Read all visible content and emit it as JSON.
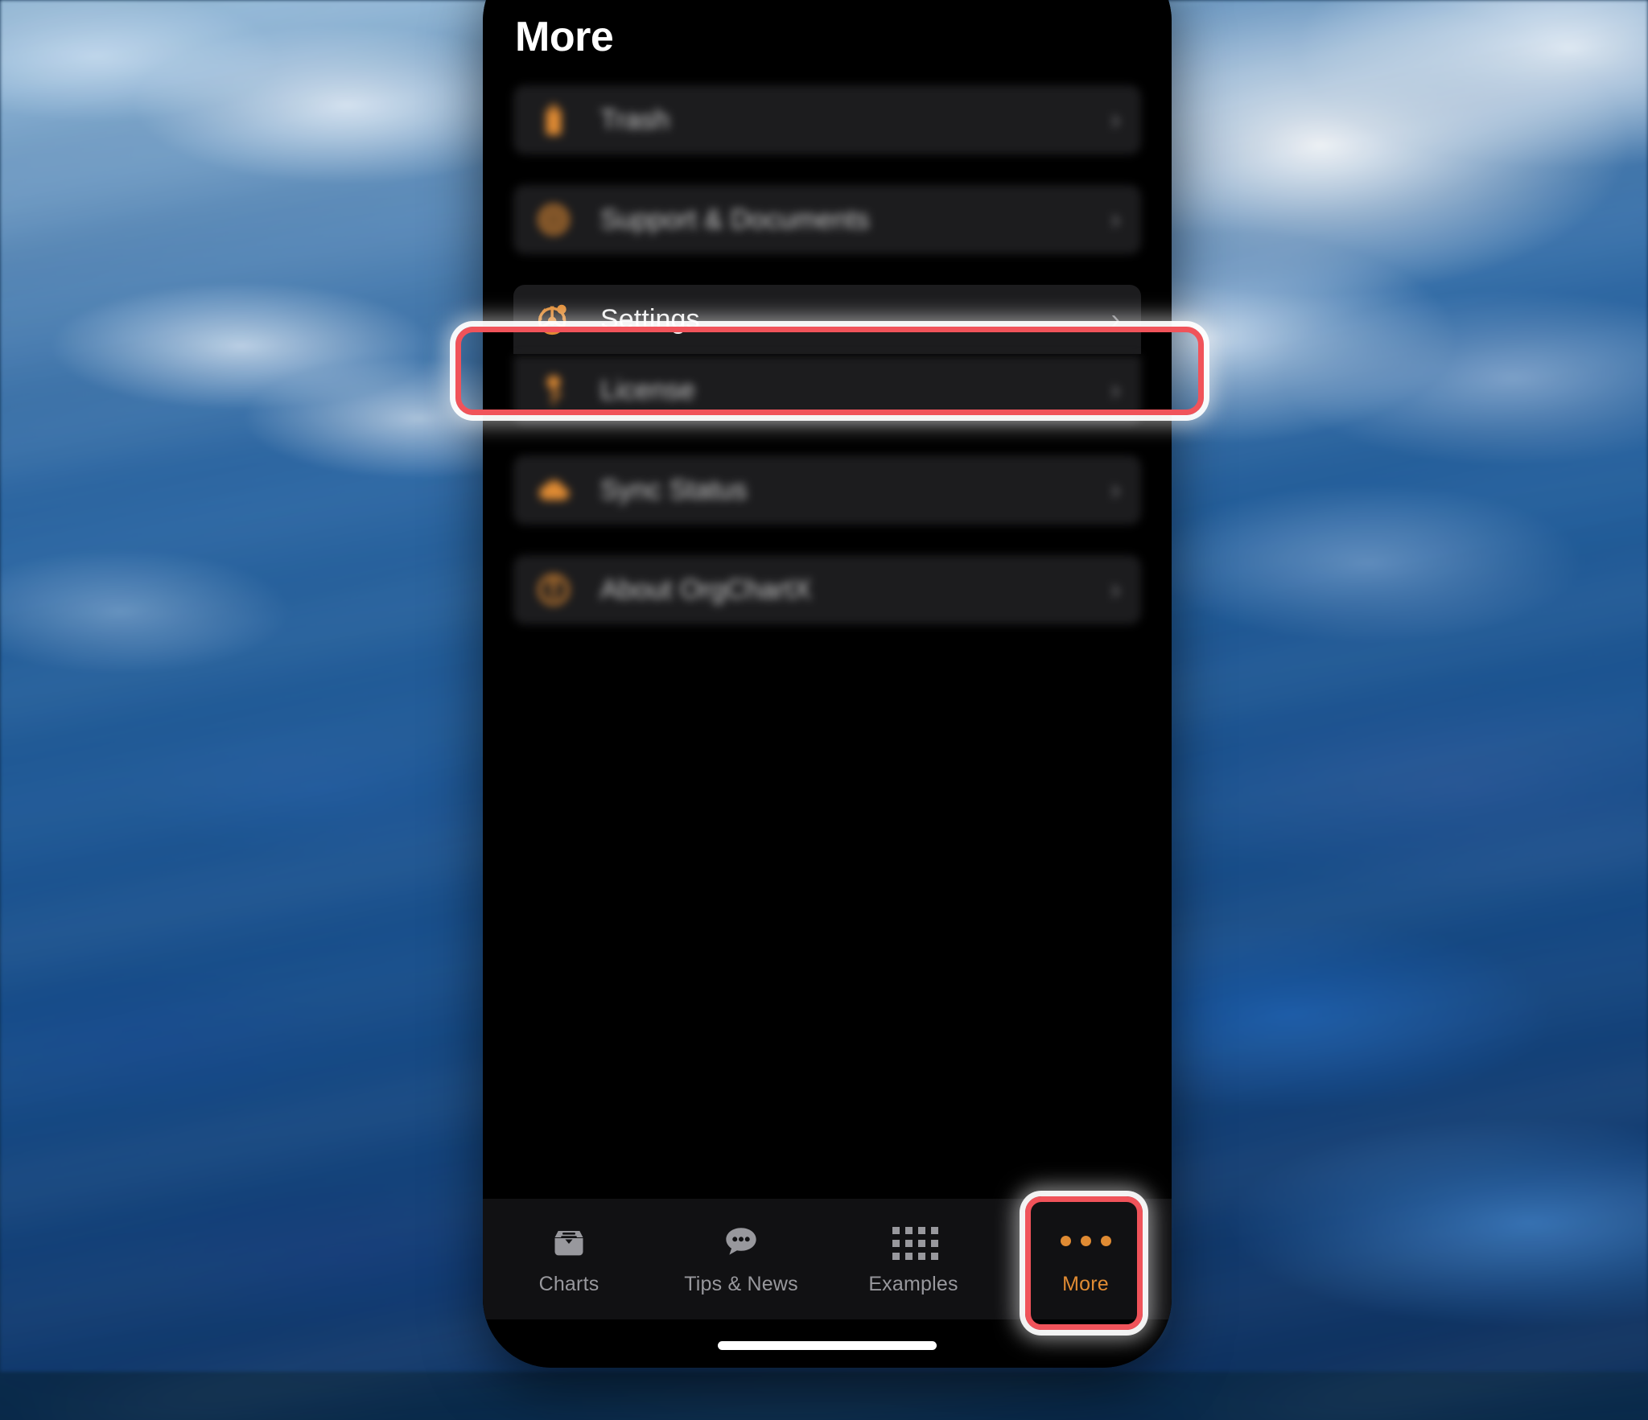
{
  "wallpaper": {
    "description": "blurred-ocean-water",
    "colors": [
      "#9fc2dd",
      "#2f6aa6",
      "#0d2f5c"
    ]
  },
  "app": {
    "name": "OrgChartX",
    "accent_color": "#e08b33",
    "background_color": "#000000",
    "row_color": "#1c1c1e"
  },
  "screen": {
    "nav_title": "More"
  },
  "list": {
    "groups": [
      {
        "rows": [
          {
            "label": "Trash",
            "icon": "trash-icon",
            "chevron": "›",
            "blurred": true
          }
        ]
      },
      {
        "rows": [
          {
            "label": "Support & Documents",
            "icon": "lifepreserver-icon",
            "chevron": "›",
            "blurred": true
          }
        ]
      },
      {
        "rows": [
          {
            "label": "Settings",
            "icon": "gear-icon",
            "chevron": "›",
            "blurred": false
          },
          {
            "label": "License",
            "icon": "key-icon",
            "chevron": "›",
            "blurred": true
          }
        ]
      },
      {
        "rows": [
          {
            "label": "Sync Status",
            "icon": "cloud-icon",
            "chevron": "›",
            "blurred": true
          }
        ]
      },
      {
        "rows": [
          {
            "label": "About OrgChartX",
            "icon": "info-circle-icon",
            "chevron": "›",
            "blurred": true
          }
        ]
      }
    ]
  },
  "tabbar": {
    "tabs": [
      {
        "label": "Charts",
        "icon": "archivebox-icon",
        "active": false
      },
      {
        "label": "Tips & News",
        "icon": "speech-bubble-icon",
        "active": false
      },
      {
        "label": "Examples",
        "icon": "grid-icon",
        "active": false
      },
      {
        "label": "More",
        "icon": "ellipsis-icon",
        "active": true
      }
    ],
    "inactive_color": "#98989d",
    "active_color": "#e08b33"
  },
  "annotations": {
    "highlight_color": "#f0535a",
    "targets": [
      "settings-row",
      "more-tab"
    ]
  }
}
